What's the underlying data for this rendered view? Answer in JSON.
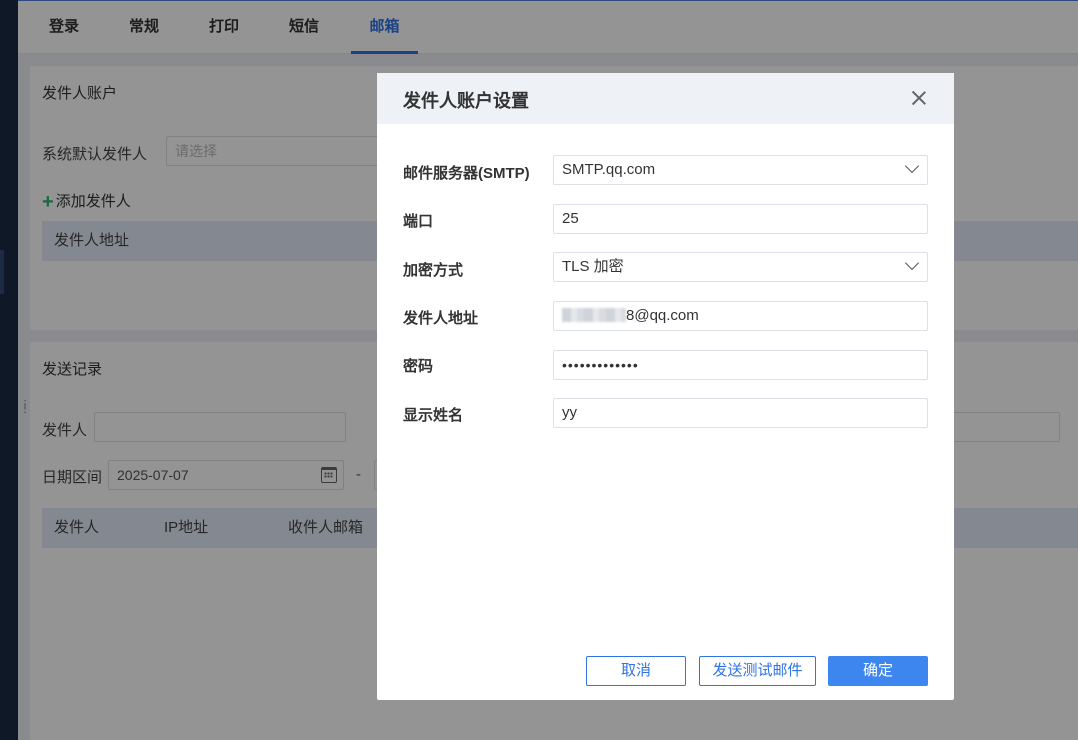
{
  "tabs": [
    "登录",
    "常规",
    "打印",
    "短信",
    "邮箱"
  ],
  "active_tab": "邮箱",
  "sender_account_section": {
    "title": "发件人账户",
    "default_sender_label": "系统默认发件人",
    "default_sender_placeholder": "请选择",
    "add_sender_label": "添加发件人",
    "table_header": "发件人地址"
  },
  "send_records_section": {
    "title": "发送记录",
    "sender_label": "发件人",
    "date_range_label": "日期区间",
    "date_start": "2025-07-07",
    "date_separator": "-",
    "columns": [
      "发件人",
      "IP地址",
      "收件人邮箱"
    ]
  },
  "dialog": {
    "title": "发件人账户设置",
    "fields": [
      {
        "label": "邮件服务器(SMTP)",
        "value": "SMTP.qq.com",
        "type": "select"
      },
      {
        "label": "端口",
        "value": "25",
        "type": "text"
      },
      {
        "label": "加密方式",
        "value": "TLS 加密",
        "type": "select"
      },
      {
        "label": "发件人地址",
        "value": "8@qq.com",
        "type": "text",
        "redacted_prefix": true
      },
      {
        "label": "密码",
        "value": "•••••••••••••",
        "type": "password"
      },
      {
        "label": "显示姓名",
        "value": "yy",
        "type": "text"
      }
    ],
    "buttons": {
      "cancel": "取消",
      "test": "发送测试邮件",
      "confirm": "确定"
    }
  },
  "colors": {
    "accent": "#2f73e6",
    "primary_button": "#3e86ef",
    "add_icon": "#2fb36c",
    "table_header_bg": "#e3ebf8",
    "left_rail": "#1b2a42"
  },
  "icons": [
    "plus-icon",
    "calendar-icon",
    "close-icon",
    "chevron-down-icon"
  ]
}
